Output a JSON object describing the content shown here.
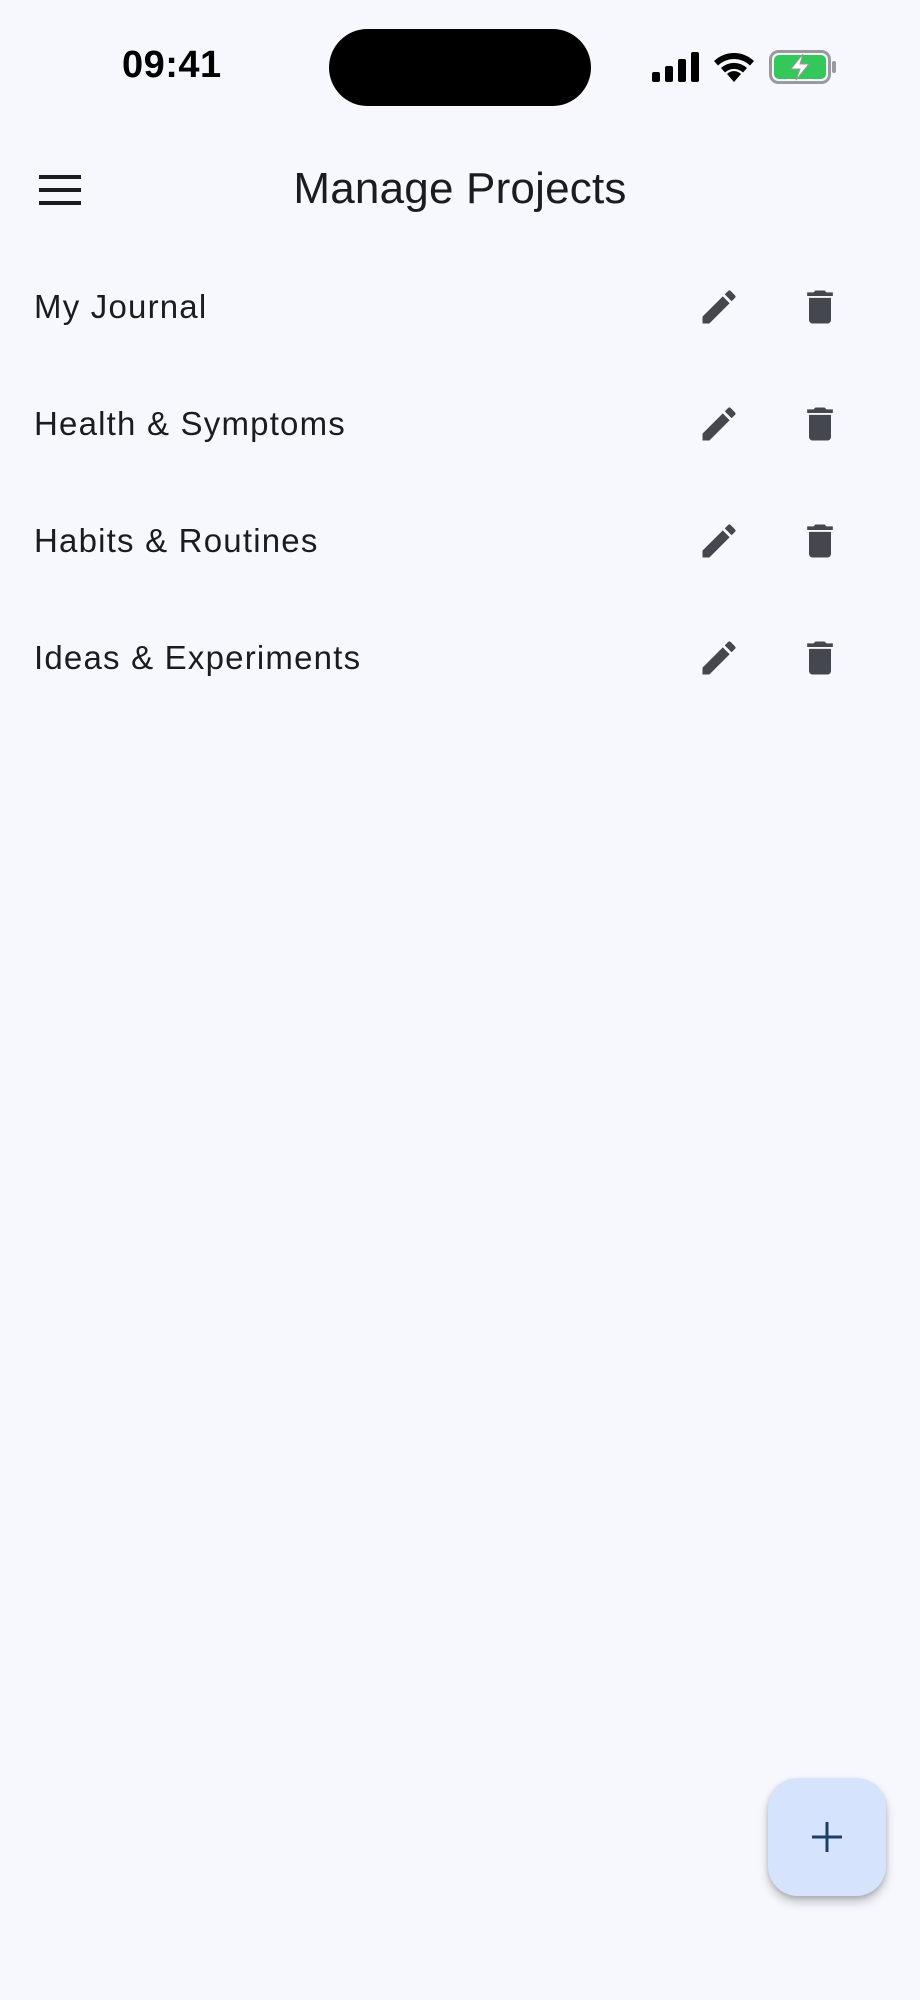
{
  "status_bar": {
    "time": "09:41",
    "icons": [
      "signal-icon",
      "wifi-icon",
      "battery-charging-icon"
    ],
    "battery_color": "#34c759"
  },
  "app_bar": {
    "title": "Manage Projects",
    "menu_icon": "menu-icon"
  },
  "projects": [
    {
      "name": "My Journal"
    },
    {
      "name": "Health & Symptoms"
    },
    {
      "name": "Habits & Routines"
    },
    {
      "name": "Ideas & Experiments"
    }
  ],
  "row_actions": {
    "edit_icon": "pencil-icon",
    "delete_icon": "trash-icon"
  },
  "fab": {
    "icon": "plus-icon",
    "color": "#d6e3fc"
  },
  "colors": {
    "background": "#f7f8fd",
    "icon": "#44474e",
    "fab_icon": "#1d3f64"
  }
}
